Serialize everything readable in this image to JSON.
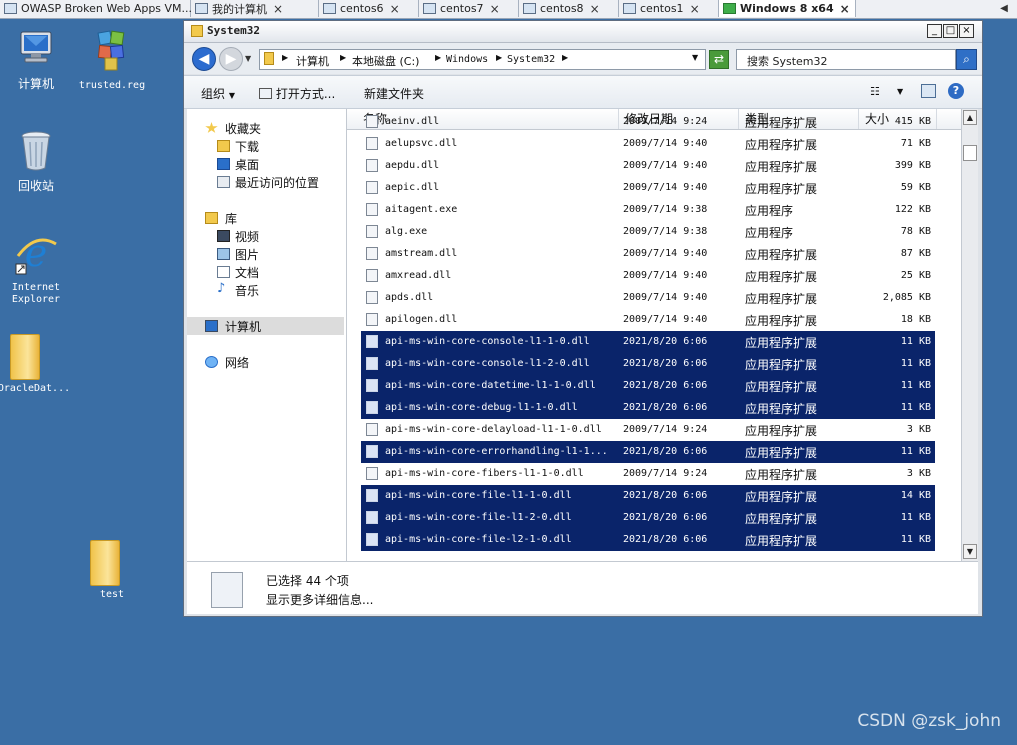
{
  "vm_tabs": [
    {
      "label": "OWASP Broken Web Apps VM...",
      "close": "×"
    },
    {
      "label": "我的计算机",
      "close": "×"
    },
    {
      "label": "centos6",
      "close": "×"
    },
    {
      "label": "centos7",
      "close": "×"
    },
    {
      "label": "centos8",
      "close": "×"
    },
    {
      "label": "centos1",
      "close": "×"
    },
    {
      "label": "Windows 8 x64",
      "close": "×"
    }
  ],
  "desktop_icons": {
    "computer": "计算机",
    "trusted_reg": "trusted.reg",
    "recycle_bin": "回收站",
    "ie_line1": "Internet",
    "ie_line2": "Explorer",
    "oracle": "OracleDat...",
    "test": "test"
  },
  "window": {
    "title": "System32",
    "address": [
      "计算机",
      "本地磁盘 (C:)",
      "Windows",
      "System32"
    ],
    "search_placeholder": "搜索 System32",
    "toolbar": {
      "organize": "组织",
      "open_with": "打开方式...",
      "new_folder": "新建文件夹"
    }
  },
  "nav": {
    "favorites": "收藏夹",
    "downloads": "下载",
    "desktop": "桌面",
    "recent": "最近访问的位置",
    "libraries": "库",
    "videos": "视频",
    "pictures": "图片",
    "documents": "文档",
    "music": "音乐",
    "computer": "计算机",
    "network": "网络"
  },
  "columns": {
    "name": "名称",
    "date": "修改日期",
    "type": "类型",
    "size": "大小"
  },
  "files": [
    {
      "name": "aeinv.dll",
      "date": "2009/7/14 9:24",
      "type": "应用程序扩展",
      "size": "415 KB",
      "selected": false
    },
    {
      "name": "aelupsvc.dll",
      "date": "2009/7/14 9:40",
      "type": "应用程序扩展",
      "size": "71 KB",
      "selected": false
    },
    {
      "name": "aepdu.dll",
      "date": "2009/7/14 9:40",
      "type": "应用程序扩展",
      "size": "399 KB",
      "selected": false
    },
    {
      "name": "aepic.dll",
      "date": "2009/7/14 9:40",
      "type": "应用程序扩展",
      "size": "59 KB",
      "selected": false
    },
    {
      "name": "aitagent.exe",
      "date": "2009/7/14 9:38",
      "type": "应用程序",
      "size": "122 KB",
      "selected": false
    },
    {
      "name": "alg.exe",
      "date": "2009/7/14 9:38",
      "type": "应用程序",
      "size": "78 KB",
      "selected": false
    },
    {
      "name": "amstream.dll",
      "date": "2009/7/14 9:40",
      "type": "应用程序扩展",
      "size": "87 KB",
      "selected": false
    },
    {
      "name": "amxread.dll",
      "date": "2009/7/14 9:40",
      "type": "应用程序扩展",
      "size": "25 KB",
      "selected": false
    },
    {
      "name": "apds.dll",
      "date": "2009/7/14 9:40",
      "type": "应用程序扩展",
      "size": "2,085 KB",
      "selected": false
    },
    {
      "name": "apilogen.dll",
      "date": "2009/7/14 9:40",
      "type": "应用程序扩展",
      "size": "18 KB",
      "selected": false
    },
    {
      "name": "api-ms-win-core-console-l1-1-0.dll",
      "date": "2021/8/20 6:06",
      "type": "应用程序扩展",
      "size": "11 KB",
      "selected": true
    },
    {
      "name": "api-ms-win-core-console-l1-2-0.dll",
      "date": "2021/8/20 6:06",
      "type": "应用程序扩展",
      "size": "11 KB",
      "selected": true
    },
    {
      "name": "api-ms-win-core-datetime-l1-1-0.dll",
      "date": "2021/8/20 6:06",
      "type": "应用程序扩展",
      "size": "11 KB",
      "selected": true
    },
    {
      "name": "api-ms-win-core-debug-l1-1-0.dll",
      "date": "2021/8/20 6:06",
      "type": "应用程序扩展",
      "size": "11 KB",
      "selected": true
    },
    {
      "name": "api-ms-win-core-delayload-l1-1-0.dll",
      "date": "2009/7/14 9:24",
      "type": "应用程序扩展",
      "size": "3 KB",
      "selected": false
    },
    {
      "name": "api-ms-win-core-errorhandling-l1-1...",
      "date": "2021/8/20 6:06",
      "type": "应用程序扩展",
      "size": "11 KB",
      "selected": true
    },
    {
      "name": "api-ms-win-core-fibers-l1-1-0.dll",
      "date": "2009/7/14 9:24",
      "type": "应用程序扩展",
      "size": "3 KB",
      "selected": false
    },
    {
      "name": "api-ms-win-core-file-l1-1-0.dll",
      "date": "2021/8/20 6:06",
      "type": "应用程序扩展",
      "size": "14 KB",
      "selected": true
    },
    {
      "name": "api-ms-win-core-file-l1-2-0.dll",
      "date": "2021/8/20 6:06",
      "type": "应用程序扩展",
      "size": "11 KB",
      "selected": true
    },
    {
      "name": "api-ms-win-core-file-l2-1-0.dll",
      "date": "2021/8/20 6:06",
      "type": "应用程序扩展",
      "size": "11 KB",
      "selected": true
    }
  ],
  "details": {
    "selected_count": "已选择 44 个项",
    "more_info": "显示更多详细信息..."
  },
  "watermark": "CSDN @zsk_john",
  "colors": {
    "selection": "#0a246a",
    "desktop": "#3a6ea5"
  }
}
